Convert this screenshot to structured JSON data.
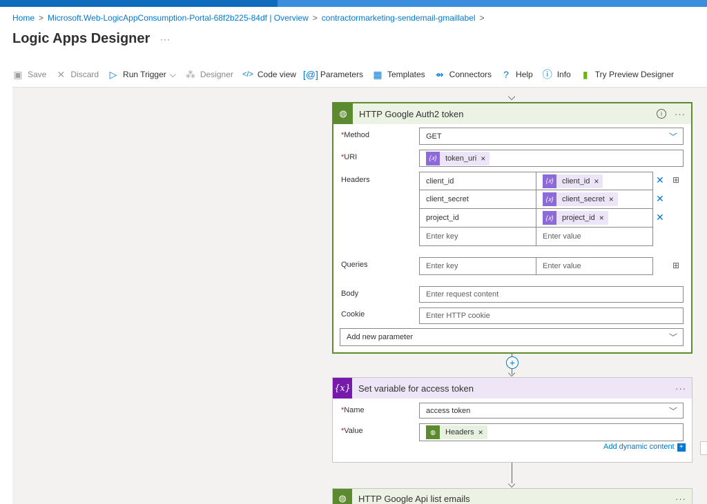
{
  "breadcrumb": {
    "home": "Home",
    "item1": "Microsoft.Web-LogicAppConsumption-Portal-68f2b225-84df | Overview",
    "item2": "contractormarketing-sendemail-gmaillabel",
    "sep": ">"
  },
  "page": {
    "title": "Logic Apps Designer",
    "more": "···"
  },
  "toolbar": {
    "save": "Save",
    "discard": "Discard",
    "run_trigger": "Run Trigger",
    "designer": "Designer",
    "code_view": "Code view",
    "parameters": "Parameters",
    "templates": "Templates",
    "connectors": "Connectors",
    "help": "Help",
    "info": "Info",
    "try_preview": "Try Preview Designer"
  },
  "http_card": {
    "title": "HTTP Google Auth2 token",
    "method_label": "Method",
    "method_value": "GET",
    "uri_label": "URI",
    "uri_token": "token_uri",
    "headers_label": "Headers",
    "headers": [
      {
        "key": "client_id",
        "value": "client_id"
      },
      {
        "key": "client_secret",
        "value": "client_secret"
      },
      {
        "key": "project_id",
        "value": "project_id"
      }
    ],
    "enter_key": "Enter key",
    "enter_value": "Enter value",
    "queries_label": "Queries",
    "body_label": "Body",
    "body_placeholder": "Enter request content",
    "cookie_label": "Cookie",
    "cookie_placeholder": "Enter HTTP cookie",
    "add_param": "Add new parameter"
  },
  "var_card": {
    "title": "Set variable for access token",
    "name_label": "Name",
    "name_value": "access token",
    "value_label": "Value",
    "value_token": "Headers",
    "add_dynamic": "Add dynamic content"
  },
  "list_card": {
    "title": "HTTP Google Api list emails"
  },
  "required_mark": "*",
  "colors": {
    "accent": "#0078d4",
    "http": "#5b8a2f",
    "variable": "#7719aa"
  }
}
